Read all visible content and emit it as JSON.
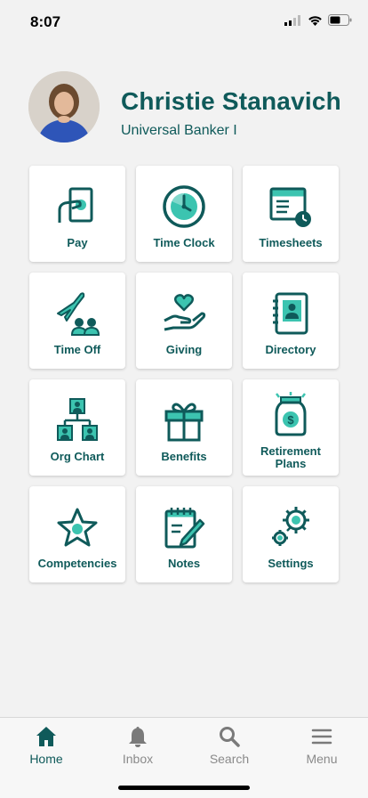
{
  "status_bar": {
    "time": "8:07"
  },
  "profile": {
    "name": "Christie Stanavich",
    "title": "Universal Banker I"
  },
  "tiles": [
    {
      "label": "Pay",
      "icon": "pay-icon"
    },
    {
      "label": "Time Clock",
      "icon": "clock-icon"
    },
    {
      "label": "Timesheets",
      "icon": "timesheets-icon"
    },
    {
      "label": "Time Off",
      "icon": "time-off-icon"
    },
    {
      "label": "Giving",
      "icon": "giving-icon"
    },
    {
      "label": "Directory",
      "icon": "directory-icon"
    },
    {
      "label": "Org Chart",
      "icon": "org-chart-icon"
    },
    {
      "label": "Benefits",
      "icon": "gift-icon"
    },
    {
      "label": "Retirement Plans",
      "icon": "retirement-jar-icon"
    },
    {
      "label": "Competencies",
      "icon": "star-icon"
    },
    {
      "label": "Notes",
      "icon": "notes-icon"
    },
    {
      "label": "Settings",
      "icon": "gears-icon"
    }
  ],
  "tab_bar": {
    "home": "Home",
    "inbox": "Inbox",
    "search": "Search",
    "menu": "Menu"
  },
  "colors": {
    "brand_dark": "#0f5a5a",
    "brand_accent": "#3cc4b0",
    "background": "#f2f2f2"
  }
}
